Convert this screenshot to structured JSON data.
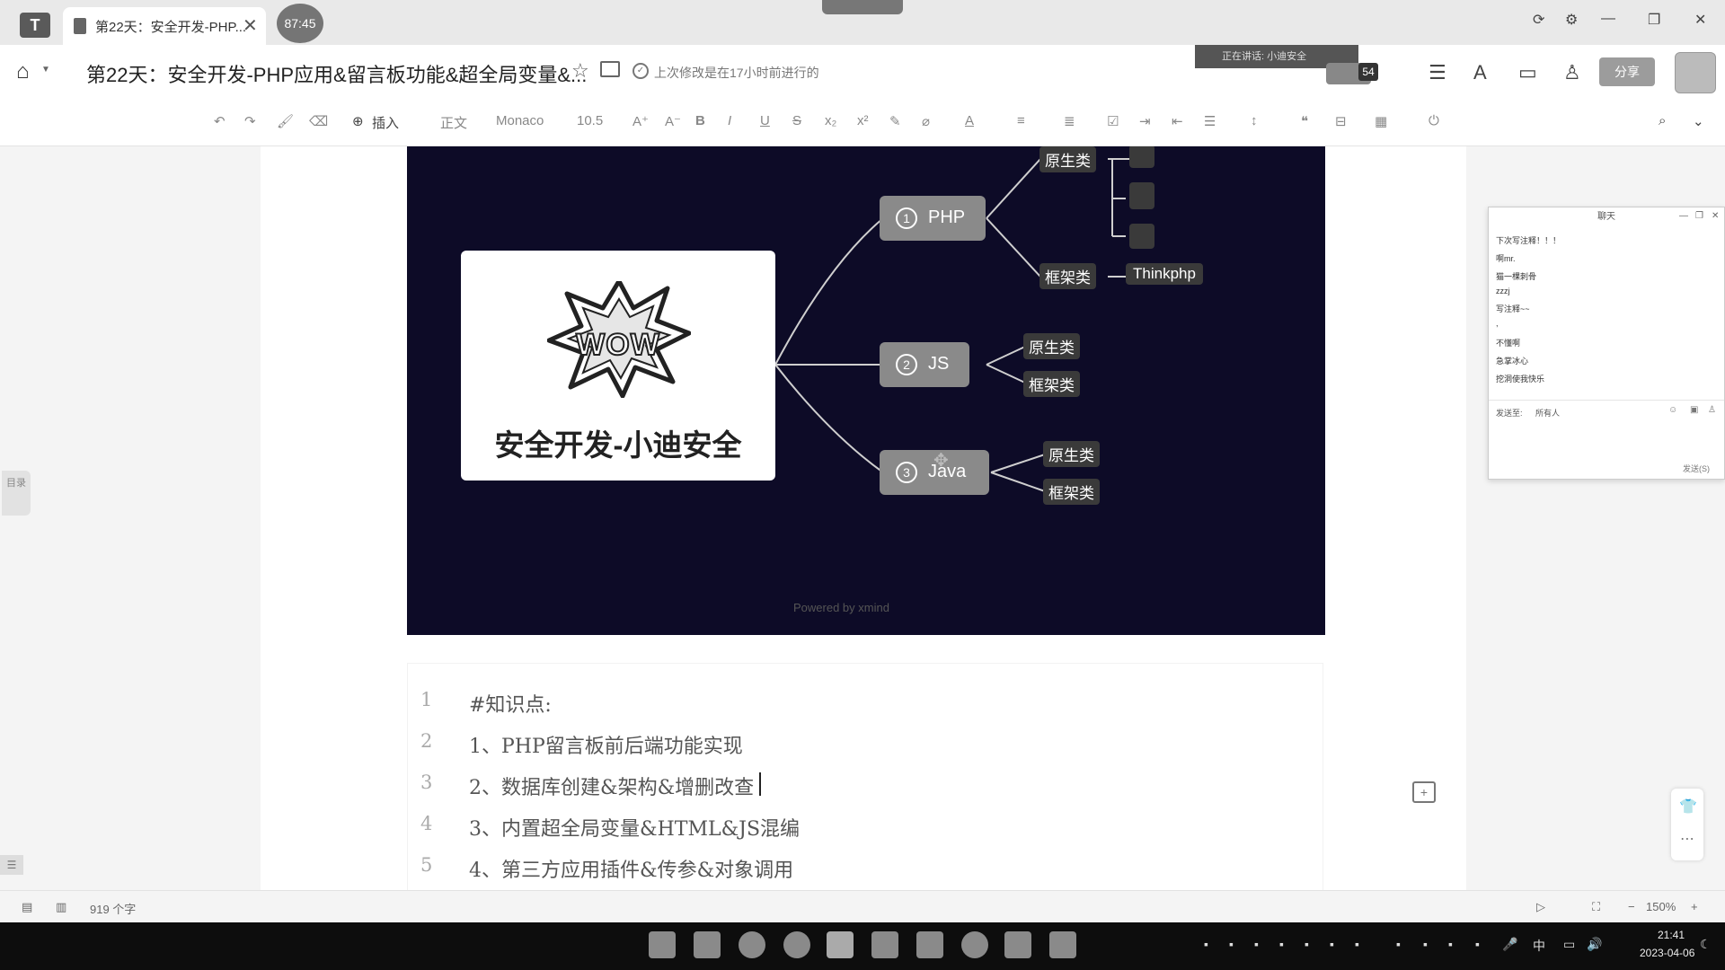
{
  "window": {
    "tab_title": "第22天：安全开发-PHP...",
    "timer": "87:45",
    "close_glyph": "✕",
    "minimize_glyph": "—",
    "maximize_glyph": "❐"
  },
  "doc": {
    "title": "第22天：安全开发-PHP应用&留言板功能&超全局变量&...",
    "saved_status": "上次修改是在17小时前进行的",
    "meeting_label": "正在讲话: 小迪安全",
    "viewer_count": "54",
    "share_label": "分享"
  },
  "toolbar": {
    "insert_label": "插入",
    "style_label": "正文",
    "font_label": "Monaco",
    "size_label": "10.5"
  },
  "mindmap": {
    "root_title": "安全开发-小迪安全",
    "logo_text": "WOW",
    "nodes": [
      {
        "num": "1",
        "label": "PHP"
      },
      {
        "num": "2",
        "label": "JS"
      },
      {
        "num": "3",
        "label": "Java"
      }
    ],
    "php_native": "原生类",
    "php_framework": "框架类",
    "php_framework_child": "Thinkphp",
    "js_native": "原生类",
    "js_framework": "框架类",
    "java_native": "原生类",
    "java_framework": "框架类",
    "watermark": "Powered by xmind"
  },
  "code": {
    "lines": [
      {
        "n": "1",
        "text": "#知识点:"
      },
      {
        "n": "2",
        "text": "1、PHP留言板前后端功能实现"
      },
      {
        "n": "3",
        "text": "2、数据库创建&架构&增删改查"
      },
      {
        "n": "4",
        "text": "3、内置超全局变量&HTML&JS混编"
      },
      {
        "n": "5",
        "text": "4、第三方应用插件&传参&对象调用"
      }
    ]
  },
  "sidebar": {
    "toc_label": "目录"
  },
  "chat": {
    "title": "聊天",
    "messages": [
      "下次写注释！！！",
      "啊mr.",
      "猫一棵刺骨",
      "zzzj",
      "写注释~~",
      ",",
      "不懂啊",
      "急掌冰心",
      "挖洞使我快乐"
    ],
    "send_to_label": "发送至:",
    "send_to_value": "所有人",
    "send_button": "发送(S)"
  },
  "statusbar": {
    "word_count": "919 个字",
    "zoom": "150%"
  },
  "taskbar": {
    "time": "21:41",
    "date": "2023-04-06",
    "ime": "中"
  }
}
